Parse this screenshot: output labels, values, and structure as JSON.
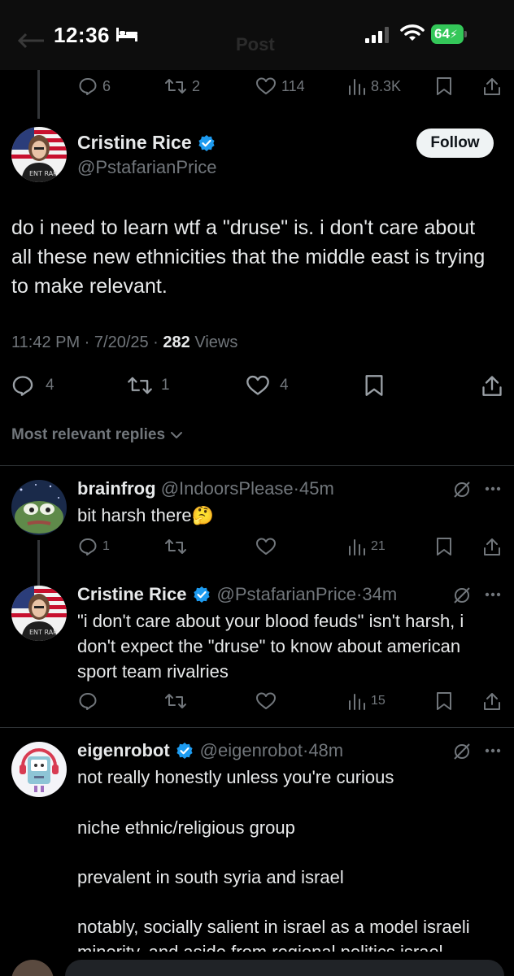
{
  "status_bar": {
    "time": "12:36",
    "battery": "64",
    "ghost_title": "Post"
  },
  "parent_actions": {
    "replies": "6",
    "reposts": "2",
    "likes": "114",
    "views": "8.3K"
  },
  "main_tweet": {
    "author_name": "Cristine Rice",
    "author_handle": "@PstafarianPrice",
    "follow_label": "Follow",
    "text": "do i need to learn wtf a \"druse\" is. i don't care about all these new ethnicities that the middle east is trying to make relevant.",
    "time": "11:42 PM · 7/20/25 · ",
    "views_count": "282",
    "views_label": " Views",
    "replies": "4",
    "reposts": "1",
    "likes": "4"
  },
  "replies_filter": {
    "label": "Most relevant replies"
  },
  "replies": [
    {
      "author_name": "brainfrog",
      "author_handle": "@IndoorsPlease",
      "time": "45m",
      "text": "bit harsh there🤔",
      "replies": "1",
      "reposts": "",
      "likes": "",
      "views": "21"
    },
    {
      "author_name": "Cristine Rice",
      "author_handle": "@PstafarianPrice",
      "time": "34m",
      "text": "\"i don't care about your blood feuds\" isn't harsh, i don't expect the \"druse\" to know about american sport team rivalries",
      "replies": "",
      "reposts": "",
      "likes": "",
      "views": "15"
    },
    {
      "author_name": "eigenrobot",
      "author_handle": "@eigenrobot",
      "time": "48m",
      "text_lines": [
        "not really honestly unless you're curious",
        "",
        "niche ethnic/religious group",
        "",
        "prevalent in south syria and israel",
        "",
        "notably, socially salient in israel as a model israeli minority, and aside from regional politics israel"
      ]
    }
  ],
  "colors": {
    "background": "#000000",
    "text_primary": "#e7e9ea",
    "text_secondary": "#71767b",
    "verified": "#1d9bf0",
    "divider": "#2f3336",
    "battery": "#34c759"
  }
}
